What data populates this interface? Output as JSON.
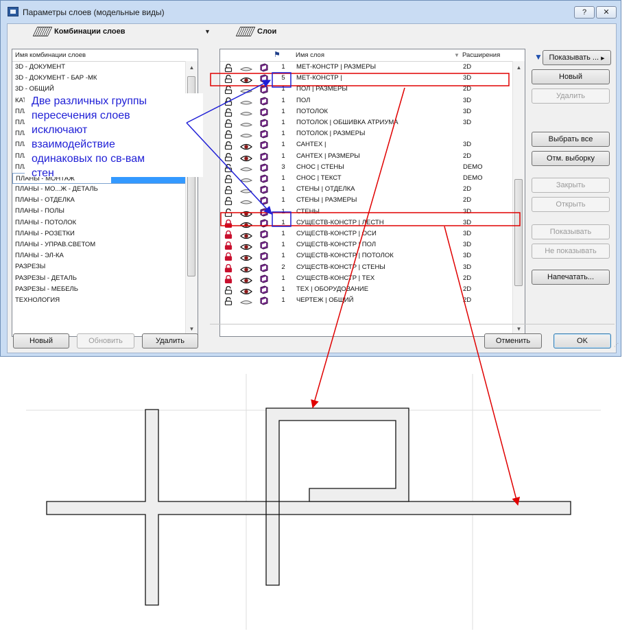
{
  "window": {
    "title": "Параметры слоев (модельные виды)",
    "help_label": "?",
    "close_label": "✕"
  },
  "left": {
    "group_title": "Комбинации слоев",
    "column_header": "Имя комбинации слоев",
    "items": [
      "3D - ДОКУМЕНТ",
      "3D - ДОКУМЕНТ - БАР -МК",
      "3D - ОБЩИЙ",
      "КАТ",
      "ПЛ/",
      "ПЛ/",
      "ПЛ/",
      "ПЛ/",
      "ПЛ/",
      "ПЛ/",
      "ПЛАНЫ - МОНТАЖ",
      "ПЛАНЫ - МО...Ж - ДЕТАЛЬ",
      "ПЛАНЫ - ОТДЕЛКА",
      "ПЛАНЫ - ПОЛЫ",
      "ПЛАНЫ - ПОТОЛОК",
      "ПЛАНЫ - РОЗЕТКИ",
      "ПЛАНЫ - УПРАВ.СВЕТОМ",
      "ПЛАНЫ - ЭЛ-КА",
      "РАЗРЕЗЫ",
      "РАЗРЕЗЫ - ДЕТАЛЬ",
      "РАЗРЕЗЫ - МЕБЕЛЬ",
      "ТЕХНОЛОГИЯ"
    ],
    "selected_index": 10,
    "btn_new": "Новый",
    "btn_update": "Обновить",
    "btn_delete": "Удалить"
  },
  "right": {
    "group_title": "Слои",
    "col_name": "Имя слоя",
    "col_ext": "Расширения",
    "show_filter": "Показывать ...",
    "btn_new": "Новый",
    "btn_delete": "Удалить",
    "btn_select_all": "Выбрать все",
    "btn_deselect": "Отм. выборку",
    "btn_lock": "Закрыть",
    "btn_unlock": "Открыть",
    "btn_show": "Показывать",
    "btn_hide": "Не показывать",
    "btn_print": "Напечатать...",
    "btn_cancel": "Отменить",
    "btn_ok": "OK",
    "layers": [
      {
        "locked": false,
        "visible": false,
        "num": "1",
        "name": "МЕТ-КОНСТР | РАЗМЕРЫ",
        "ext": "2D"
      },
      {
        "locked": false,
        "visible": true,
        "num": "5",
        "name": "МЕТ-КОНСТР |",
        "ext": "3D"
      },
      {
        "locked": false,
        "visible": false,
        "num": "1",
        "name": "ПОЛ | РАЗМЕРЫ",
        "ext": "2D"
      },
      {
        "locked": false,
        "visible": false,
        "num": "1",
        "name": "ПОЛ",
        "ext": "3D"
      },
      {
        "locked": false,
        "visible": false,
        "num": "1",
        "name": "ПОТОЛОК",
        "ext": "3D"
      },
      {
        "locked": false,
        "visible": false,
        "num": "1",
        "name": "ПОТОЛОК | ОБШИВКА АТРИУМА",
        "ext": "3D"
      },
      {
        "locked": false,
        "visible": false,
        "num": "1",
        "name": "ПОТОЛОК | РАЗМЕРЫ",
        "ext": ""
      },
      {
        "locked": false,
        "visible": true,
        "num": "1",
        "name": "САНТЕХ |",
        "ext": "3D"
      },
      {
        "locked": false,
        "visible": true,
        "num": "1",
        "name": "САНТЕХ | РАЗМЕРЫ",
        "ext": "2D"
      },
      {
        "locked": false,
        "visible": false,
        "num": "3",
        "name": "СНОС | СТЕНЫ",
        "ext": "DEMO"
      },
      {
        "locked": false,
        "visible": false,
        "num": "1",
        "name": "СНОС | ТЕКСТ",
        "ext": "DEMO"
      },
      {
        "locked": false,
        "visible": false,
        "num": "1",
        "name": "СТЕНЫ | ОТДЕЛКА",
        "ext": "2D"
      },
      {
        "locked": false,
        "visible": false,
        "num": "1",
        "name": "СТЕНЫ | РАЗМЕРЫ",
        "ext": "2D"
      },
      {
        "locked": false,
        "visible": true,
        "num": "1",
        "name": "СТЕНЫ",
        "ext": "3D"
      },
      {
        "locked": true,
        "visible": true,
        "num": "1",
        "name": "СУЩЕСТВ-КОНСТР | ЛЕСТН",
        "ext": "3D"
      },
      {
        "locked": true,
        "visible": true,
        "num": "1",
        "name": "СУЩЕСТВ-КОНСТР | ОСИ",
        "ext": "3D"
      },
      {
        "locked": true,
        "visible": true,
        "num": "1",
        "name": "СУЩЕСТВ-КОНСТР | ПОЛ",
        "ext": "3D"
      },
      {
        "locked": true,
        "visible": true,
        "num": "1",
        "name": "СУЩЕСТВ-КОНСТР | ПОТОЛОК",
        "ext": "3D"
      },
      {
        "locked": true,
        "visible": true,
        "num": "2",
        "name": "СУЩЕСТВ-КОНСТР | СТЕНЫ",
        "ext": "3D"
      },
      {
        "locked": true,
        "visible": true,
        "num": "1",
        "name": "СУЩЕСТВ-КОНСТР | ТЕХ",
        "ext": "2D"
      },
      {
        "locked": false,
        "visible": true,
        "num": "1",
        "name": "ТЕХ | ОБОРУДОВАНИЕ",
        "ext": "2D"
      },
      {
        "locked": false,
        "visible": false,
        "num": "1",
        "name": "ЧЕРТЕЖ | ОБЩИЙ",
        "ext": "2D"
      }
    ]
  },
  "annotation": {
    "lines": [
      "Две различных группы",
      "пересечения слоев",
      "исключают",
      "взаимодействие",
      "одинаковых по св-вам",
      "стен"
    ]
  },
  "colors": {
    "callout_text": "#1f1fd6",
    "red_marks": "#e00000",
    "blue_marks": "#1f1fd6",
    "selection": "#3399ff"
  }
}
